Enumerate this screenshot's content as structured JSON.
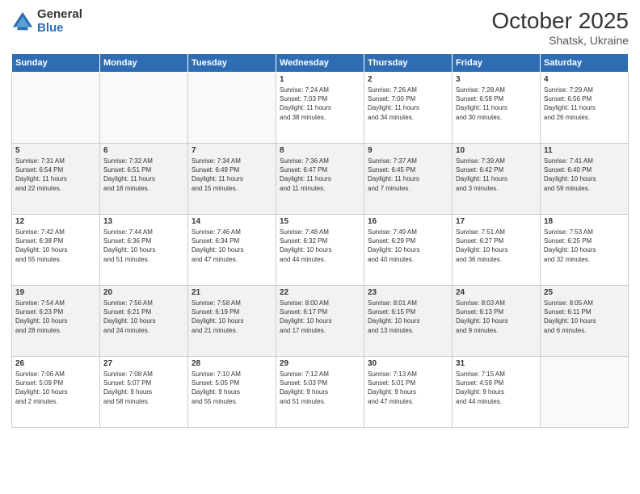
{
  "logo": {
    "general": "General",
    "blue": "Blue"
  },
  "header": {
    "title": "October 2025",
    "subtitle": "Shatsk, Ukraine"
  },
  "weekdays": [
    "Sunday",
    "Monday",
    "Tuesday",
    "Wednesday",
    "Thursday",
    "Friday",
    "Saturday"
  ],
  "weeks": [
    [
      {
        "day": "",
        "info": ""
      },
      {
        "day": "",
        "info": ""
      },
      {
        "day": "",
        "info": ""
      },
      {
        "day": "1",
        "info": "Sunrise: 7:24 AM\nSunset: 7:03 PM\nDaylight: 11 hours\nand 38 minutes."
      },
      {
        "day": "2",
        "info": "Sunrise: 7:26 AM\nSunset: 7:00 PM\nDaylight: 11 hours\nand 34 minutes."
      },
      {
        "day": "3",
        "info": "Sunrise: 7:28 AM\nSunset: 6:58 PM\nDaylight: 11 hours\nand 30 minutes."
      },
      {
        "day": "4",
        "info": "Sunrise: 7:29 AM\nSunset: 6:56 PM\nDaylight: 11 hours\nand 26 minutes."
      }
    ],
    [
      {
        "day": "5",
        "info": "Sunrise: 7:31 AM\nSunset: 6:54 PM\nDaylight: 11 hours\nand 22 minutes."
      },
      {
        "day": "6",
        "info": "Sunrise: 7:32 AM\nSunset: 6:51 PM\nDaylight: 11 hours\nand 18 minutes."
      },
      {
        "day": "7",
        "info": "Sunrise: 7:34 AM\nSunset: 6:49 PM\nDaylight: 11 hours\nand 15 minutes."
      },
      {
        "day": "8",
        "info": "Sunrise: 7:36 AM\nSunset: 6:47 PM\nDaylight: 11 hours\nand 11 minutes."
      },
      {
        "day": "9",
        "info": "Sunrise: 7:37 AM\nSunset: 6:45 PM\nDaylight: 11 hours\nand 7 minutes."
      },
      {
        "day": "10",
        "info": "Sunrise: 7:39 AM\nSunset: 6:42 PM\nDaylight: 11 hours\nand 3 minutes."
      },
      {
        "day": "11",
        "info": "Sunrise: 7:41 AM\nSunset: 6:40 PM\nDaylight: 10 hours\nand 59 minutes."
      }
    ],
    [
      {
        "day": "12",
        "info": "Sunrise: 7:42 AM\nSunset: 6:38 PM\nDaylight: 10 hours\nand 55 minutes."
      },
      {
        "day": "13",
        "info": "Sunrise: 7:44 AM\nSunset: 6:36 PM\nDaylight: 10 hours\nand 51 minutes."
      },
      {
        "day": "14",
        "info": "Sunrise: 7:46 AM\nSunset: 6:34 PM\nDaylight: 10 hours\nand 47 minutes."
      },
      {
        "day": "15",
        "info": "Sunrise: 7:48 AM\nSunset: 6:32 PM\nDaylight: 10 hours\nand 44 minutes."
      },
      {
        "day": "16",
        "info": "Sunrise: 7:49 AM\nSunset: 6:29 PM\nDaylight: 10 hours\nand 40 minutes."
      },
      {
        "day": "17",
        "info": "Sunrise: 7:51 AM\nSunset: 6:27 PM\nDaylight: 10 hours\nand 36 minutes."
      },
      {
        "day": "18",
        "info": "Sunrise: 7:53 AM\nSunset: 6:25 PM\nDaylight: 10 hours\nand 32 minutes."
      }
    ],
    [
      {
        "day": "19",
        "info": "Sunrise: 7:54 AM\nSunset: 6:23 PM\nDaylight: 10 hours\nand 28 minutes."
      },
      {
        "day": "20",
        "info": "Sunrise: 7:56 AM\nSunset: 6:21 PM\nDaylight: 10 hours\nand 24 minutes."
      },
      {
        "day": "21",
        "info": "Sunrise: 7:58 AM\nSunset: 6:19 PM\nDaylight: 10 hours\nand 21 minutes."
      },
      {
        "day": "22",
        "info": "Sunrise: 8:00 AM\nSunset: 6:17 PM\nDaylight: 10 hours\nand 17 minutes."
      },
      {
        "day": "23",
        "info": "Sunrise: 8:01 AM\nSunset: 6:15 PM\nDaylight: 10 hours\nand 13 minutes."
      },
      {
        "day": "24",
        "info": "Sunrise: 8:03 AM\nSunset: 6:13 PM\nDaylight: 10 hours\nand 9 minutes."
      },
      {
        "day": "25",
        "info": "Sunrise: 8:05 AM\nSunset: 6:11 PM\nDaylight: 10 hours\nand 6 minutes."
      }
    ],
    [
      {
        "day": "26",
        "info": "Sunrise: 7:06 AM\nSunset: 5:09 PM\nDaylight: 10 hours\nand 2 minutes."
      },
      {
        "day": "27",
        "info": "Sunrise: 7:08 AM\nSunset: 5:07 PM\nDaylight: 9 hours\nand 58 minutes."
      },
      {
        "day": "28",
        "info": "Sunrise: 7:10 AM\nSunset: 5:05 PM\nDaylight: 9 hours\nand 55 minutes."
      },
      {
        "day": "29",
        "info": "Sunrise: 7:12 AM\nSunset: 5:03 PM\nDaylight: 9 hours\nand 51 minutes."
      },
      {
        "day": "30",
        "info": "Sunrise: 7:13 AM\nSunset: 5:01 PM\nDaylight: 9 hours\nand 47 minutes."
      },
      {
        "day": "31",
        "info": "Sunrise: 7:15 AM\nSunset: 4:59 PM\nDaylight: 9 hours\nand 44 minutes."
      },
      {
        "day": "",
        "info": ""
      }
    ]
  ]
}
